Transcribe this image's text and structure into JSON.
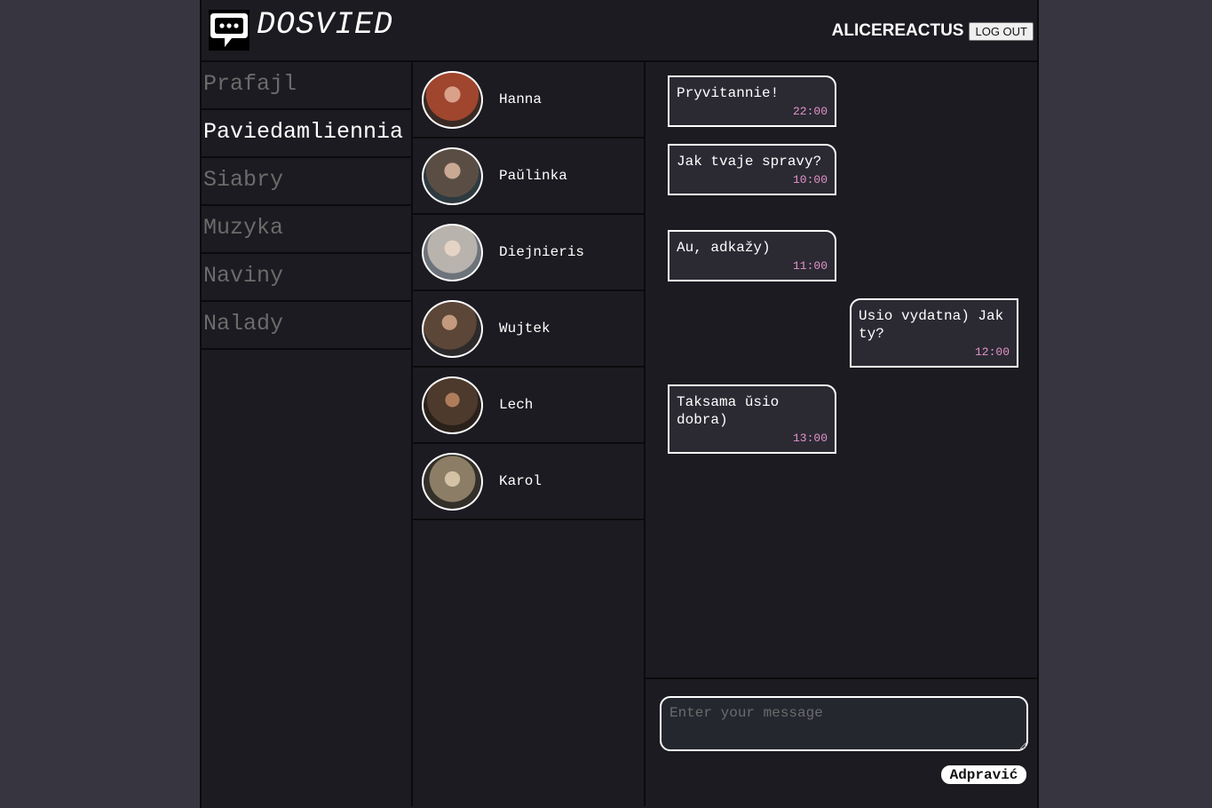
{
  "header": {
    "brand": "DOSVIED",
    "logo_icon": "chat-bubble-icon",
    "username": "ALICEREACTUS",
    "logout_label": "LOG OUT"
  },
  "nav": {
    "items": [
      {
        "label": "Prafajl",
        "active": false
      },
      {
        "label": "Paviedamliennia",
        "active": true
      },
      {
        "label": "Siabry",
        "active": false
      },
      {
        "label": "Muzyka",
        "active": false
      },
      {
        "label": "Naviny",
        "active": false
      },
      {
        "label": "Nalady",
        "active": false
      }
    ]
  },
  "contacts": [
    {
      "name": "Hanna",
      "avatar_color": "#a0452e"
    },
    {
      "name": "Paŭlinka",
      "avatar_color": "#5a4e44"
    },
    {
      "name": "Diejnieris",
      "avatar_color": "#b9b3ad"
    },
    {
      "name": "Wujtek",
      "avatar_color": "#5c4638"
    },
    {
      "name": "Lech",
      "avatar_color": "#4d3a2c"
    },
    {
      "name": "Karol",
      "avatar_color": "#8c7d66"
    }
  ],
  "messages": [
    {
      "text": "Pryvitannie!",
      "time": "22:00",
      "direction": "in"
    },
    {
      "text": "Jak tvaje spravy?",
      "time": "10:00",
      "direction": "in"
    },
    {
      "text": "Au, adkažy)",
      "time": "11:00",
      "direction": "in"
    },
    {
      "text": "Usio vydatna) Jak ty?",
      "time": "12:00",
      "direction": "out"
    },
    {
      "text": "Taksama ŭsio dobra)",
      "time": "13:00",
      "direction": "in"
    }
  ],
  "composer": {
    "placeholder": "Enter your message",
    "send_label": "Adpravić"
  },
  "colors": {
    "page_bg": "#37353f",
    "panel_bg": "#1c1b21",
    "bubble_bg": "#2b2a33",
    "time_color": "#e493c9",
    "inactive_nav": "#6b6b6b"
  }
}
